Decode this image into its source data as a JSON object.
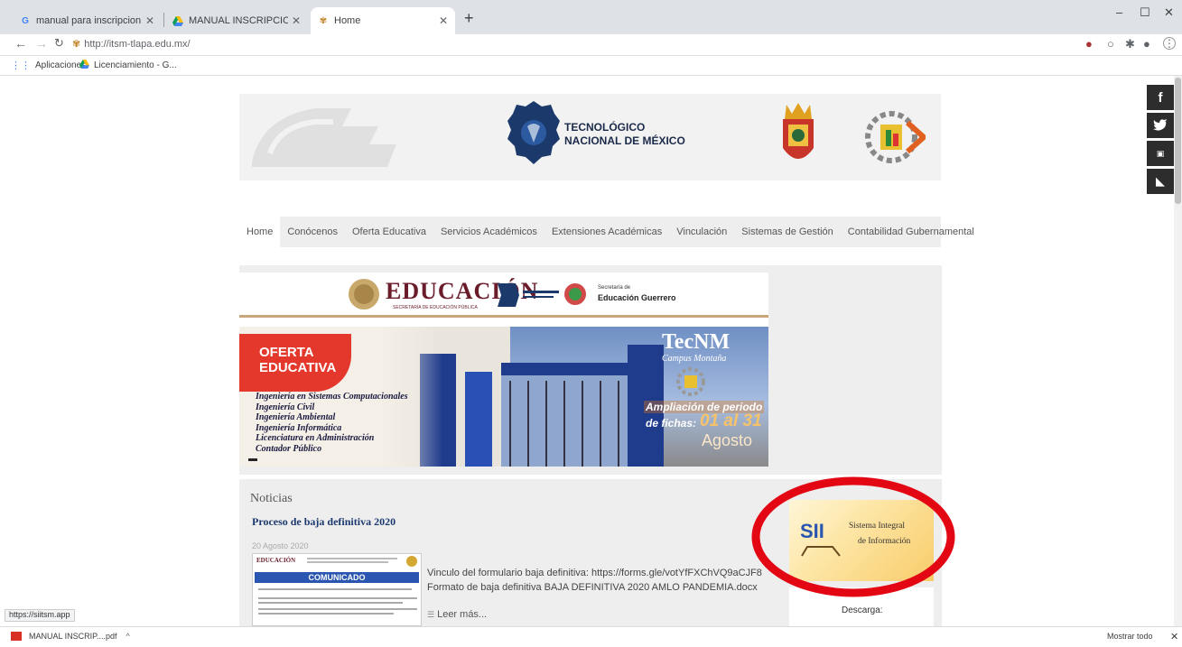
{
  "browser": {
    "tabs": [
      {
        "title": "manual para inscripcion SII - Bus",
        "favicon": "google-icon"
      },
      {
        "title": "MANUAL INSCRIPCION ALUMNI",
        "favicon": "drive-icon"
      },
      {
        "title": "Home",
        "favicon": "itsm-icon"
      }
    ],
    "url": "http://itsm-tlapa.edu.mx/",
    "bookmarks": [
      {
        "label": "Aplicaciones"
      },
      {
        "label": "Licenciamiento - G..."
      }
    ],
    "status_url": "https://siitsm.app",
    "download": {
      "filename": "MANUAL INSCRIP....pdf",
      "show_all": "Mostrar todo"
    }
  },
  "site": {
    "logo_text": "TECNOLÓGICO NACIONAL DE MÉXICO",
    "menu": [
      "Home",
      "Conócenos",
      "Oferta Educativa",
      "Servicios Académicos",
      "Extensiones Académicas",
      "Vinculación",
      "Sistemas de Gestión",
      "Contabilidad Gubernamental"
    ],
    "banner": {
      "educacion": "EDUCACIÓN",
      "sep_sub": "SECRETARÍA DE EDUCACIÓN PÚBLICA",
      "guerrero_small": "Secretaría de",
      "guerrero": "Educación Guerrero",
      "oferta": "OFERTA EDUCATIVA",
      "carreras": [
        "Ingeniería en Sistemas Computacionales",
        "Ingeniería Civil",
        "Ingeniería Ambiental",
        "Ingeniería Informática",
        "Licenciatura en Administración",
        "Contador Público"
      ],
      "tecnm": "TecNM",
      "campus": "Campus Montaña",
      "ampliacion": "Ampliación de periodo",
      "fichas_label": "de fichas:",
      "fichas_dates": "01 al 31",
      "mes": "Agosto"
    },
    "news": {
      "section_title": "Noticias",
      "headline": "Proceso de baja definitiva 2020",
      "date": "20 Agosto 2020",
      "comunicado": "COMUNICADO",
      "body_line1": "Vinculo del formulario baja definitiva: https://forms.gle/votYfFXChVQ9aCJF8",
      "body_line2": "Formato de baja definitiva BAJA DEFINITIVA 2020 AMLO PANDEMIA.docx",
      "read_more": "Leer más..."
    },
    "sii": {
      "abbr": "SII",
      "line1": "Sistema Integral",
      "line2": "de Información",
      "descarga": "Descarga:"
    },
    "social": [
      "f",
      "t",
      "yt",
      "rss"
    ]
  },
  "colors": {
    "highlight_ring": "#e30613",
    "accent_red": "#e3382b",
    "banner_blue": "#1f3b8c"
  }
}
